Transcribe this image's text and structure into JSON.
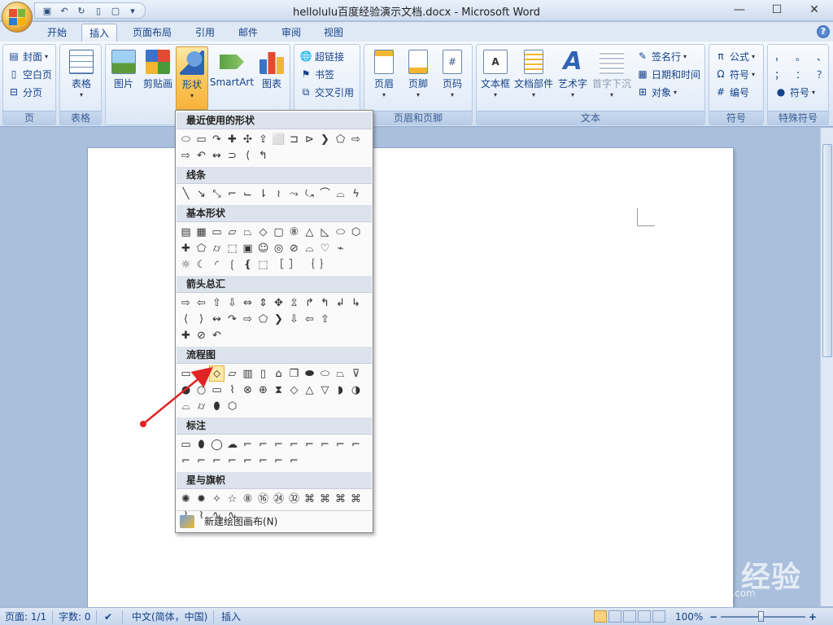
{
  "window": {
    "title": "hellolulu百度经验演示文档.docx - Microsoft Word",
    "minimize": "—",
    "maximize": "☐",
    "close": "✕"
  },
  "qat": {
    "items": [
      "save-icon",
      "undo-icon",
      "redo-icon",
      "new-doc-icon",
      "print-preview-icon"
    ]
  },
  "tabs": [
    {
      "label": "开始"
    },
    {
      "label": "插入",
      "active": true
    },
    {
      "label": "页面布局"
    },
    {
      "label": "引用"
    },
    {
      "label": "邮件"
    },
    {
      "label": "审阅"
    },
    {
      "label": "视图"
    }
  ],
  "ribbon": {
    "page": {
      "label": "页",
      "cover": "封面",
      "blank": "空白页",
      "break": "分页"
    },
    "table": {
      "label": "表格",
      "button": "表格"
    },
    "illustrations": {
      "picture": "图片",
      "clipart": "剪贴画",
      "shapes": "形状",
      "smartart": "SmartArt",
      "chart": "图表"
    },
    "links": {
      "hyperlink": "超链接",
      "bookmark": "书签",
      "crossref": "交叉引用"
    },
    "headerfooter": {
      "label": "页眉和页脚",
      "header": "页眉",
      "footer": "页脚",
      "pagenum": "页码"
    },
    "text": {
      "label": "文本",
      "textbox": "文本框",
      "quickparts": "文档部件",
      "wordart": "艺术字",
      "dropcap": "首字下沉",
      "signature": "签名行",
      "datetime": "日期和时间",
      "object": "对象"
    },
    "symbols": {
      "label": "符号",
      "equation": "公式",
      "symbol": "符号",
      "number": "编号"
    },
    "special": {
      "label": "特殊符号",
      "symbol": "符号",
      "chars": [
        "，",
        "。",
        "、",
        "；",
        "：",
        "？"
      ]
    }
  },
  "shapes_menu": {
    "sections": [
      {
        "title": "最近使用的形状",
        "rows": [
          [
            "⬭",
            "▭",
            "↷",
            "✚",
            "✣",
            "⇪",
            "⬜",
            "⊐",
            "⊳",
            "❯",
            "⬠",
            "⇨"
          ],
          [
            "⇨",
            "↶",
            "↭",
            "⊃",
            "⟨",
            "↰"
          ]
        ]
      },
      {
        "title": "线条",
        "rows": [
          [
            "╲",
            "↘",
            "⤡",
            "⌐",
            "⌙",
            "⇂",
            "≀",
            "⤳",
            "⤿",
            "⌒",
            "⌓",
            "ϟ"
          ]
        ]
      },
      {
        "title": "基本形状",
        "rows": [
          [
            "▤",
            "▦",
            "▭",
            "▱",
            "⏢",
            "◇",
            "▢",
            "⑧",
            "△",
            "◺",
            "⬭",
            "⬡"
          ],
          [
            "✚",
            "⬠",
            "⌭",
            "⬚",
            "▣",
            "☺",
            "◎",
            "⊘",
            "⌓",
            "♡",
            "⌁"
          ],
          [
            "☼",
            "☾",
            "◜",
            "❲",
            "❴",
            "⬚",
            "［",
            "］",
            "｛",
            "｝"
          ]
        ]
      },
      {
        "title": "箭头总汇",
        "rows": [
          [
            "⇨",
            "⇦",
            "⇧",
            "⇩",
            "⇔",
            "⇕",
            "✥",
            "⇫",
            "↱",
            "↰",
            "↲",
            "↳"
          ],
          [
            "⟨",
            "⟩",
            "↭",
            "↷",
            "⇨",
            "⬠",
            "❯",
            "⇩",
            "⇦",
            "⇧"
          ],
          [
            "✚",
            "⊘",
            "↶"
          ]
        ]
      },
      {
        "title": "流程图",
        "rows": [
          [
            "▭",
            "⬭",
            "⬦",
            "▱",
            "▥",
            "▯",
            "⌂",
            "❒",
            "⬬",
            "⬭",
            "⏢",
            "⊽"
          ],
          [
            "●",
            "○",
            "▭",
            "⌇",
            "⊗",
            "⊕",
            "⧗",
            "◇",
            "△",
            "▽",
            "◗",
            "◑"
          ],
          [
            "⌓",
            "⌭",
            "⬮",
            "⬡"
          ]
        ]
      },
      {
        "title": "标注",
        "rows": [
          [
            "▭",
            "⬮",
            "◯",
            "☁",
            "⌐",
            "⌐",
            "⌐",
            "⌐",
            "⌐",
            "⌐",
            "⌐",
            "⌐"
          ],
          [
            "⌐",
            "⌐",
            "⌐",
            "⌐",
            "⌐",
            "⌐",
            "⌐",
            "⌐"
          ]
        ]
      },
      {
        "title": "星与旗帜",
        "rows": [
          [
            "✺",
            "✹",
            "✧",
            "☆",
            "⑧",
            "⑯",
            "㉔",
            "㉜",
            "⌘",
            "⌘",
            "⌘",
            "⌘"
          ],
          [
            "⌇",
            "⌇",
            "∿",
            "∿"
          ]
        ]
      }
    ],
    "footer": "新建绘图画布(N)"
  },
  "statusbar": {
    "page": "页面: 1/1",
    "words": "字数: 0",
    "lang": "中文(简体，中国)",
    "mode": "插入",
    "zoom": "100%",
    "zoom_out": "−",
    "zoom_in": "+"
  },
  "watermark": {
    "brand": "Bai du 经验",
    "url": "jingyan.baidu.com"
  }
}
